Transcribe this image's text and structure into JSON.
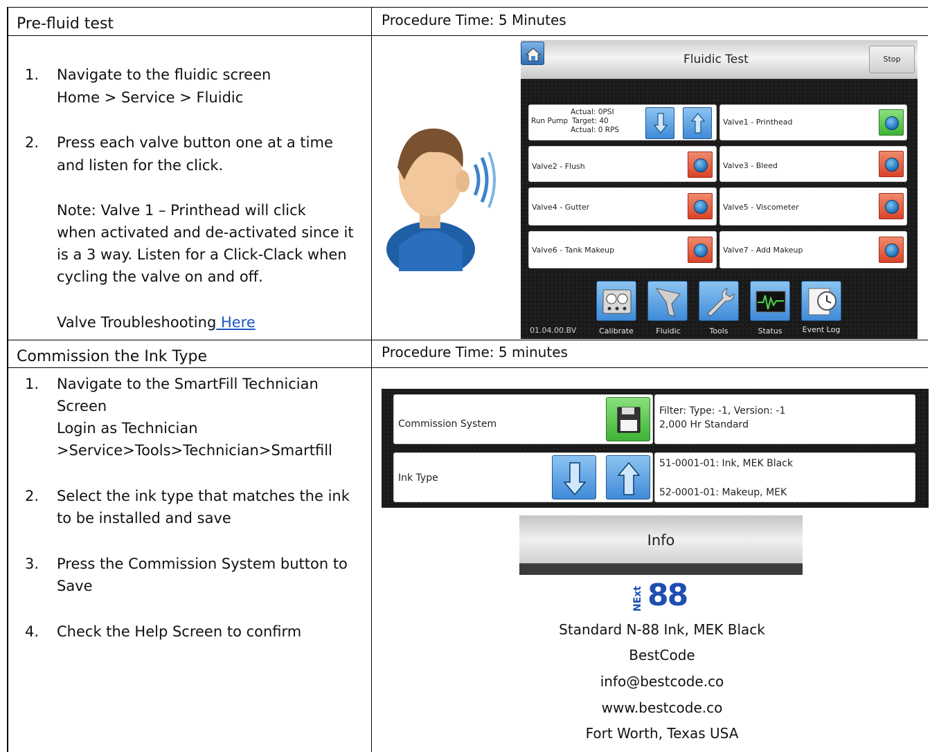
{
  "section1": {
    "title": "Pre-fluid test",
    "procedure_time": "Procedure Time: 5 Minutes",
    "step1_num": "1.",
    "step1_line1": "Navigate to the fluidic screen",
    "step1_line2": "Home > Service > Fluidic",
    "step2_num": "2.",
    "step2_line1": "Press each valve button one at a time",
    "step2_line2": "and listen for the click.",
    "note_line1": "Note: Valve 1 – Printhead will click",
    "note_line2": "when activated and de-activated since it",
    "note_line3": "is a 3 way. Listen for a Click-Clack when",
    "note_line4": "cycling the valve on and off.",
    "trouble_text": "Valve Troubleshooting",
    "trouble_link": " Here"
  },
  "fluidic_screen": {
    "title": "Fluidic Test",
    "stop_label": "Stop",
    "pump_actual_psi": "Actual: 0PSI",
    "pump_label": "Run Pump",
    "pump_target": "Target: 40",
    "pump_actual_rps": "Actual: 0 RPS",
    "valves": [
      "Valve1 - Printhead",
      "Valve2 - Flush",
      "Valve3 - Bleed",
      "Valve4 - Gutter",
      "Valve5 - Viscometer",
      "Valve6 - Tank Makeup",
      "Valve7 - Add Makeup"
    ],
    "version": "01.04.00.BV",
    "nav": [
      "Calibrate",
      "Fluidic",
      "Tools",
      "Status",
      "Event Log"
    ]
  },
  "section2": {
    "title": "Commission the Ink Type",
    "procedure_time": "Procedure Time: 5 minutes",
    "s1_num": "1.",
    "s1_line1": "Navigate to the SmartFill Technician",
    "s1_line2": "Screen",
    "s1_line3": "Login as Technician",
    "s1_line4": ">Service>Tools>Technician>Smartfill",
    "s2_num": "2.",
    "s2_line1": "Select the ink type that matches the ink",
    "s2_line2": "to be installed and save",
    "s3_num": "3.",
    "s3_line1": "Press the Commission System button to",
    "s3_line2": "Save",
    "s4_num": "4.",
    "s4_line1": "Check the Help Screen to confirm"
  },
  "commission_screen": {
    "commission_label": "Commission System",
    "filter_line1": "Filter: Type: -1, Version: -1",
    "filter_line2": "2,000 Hr Standard",
    "ink_type_label": "Ink Type",
    "ink_line1": "51-0001-01: Ink, MEK Black",
    "ink_line2": "52-0001-01: Makeup, MEK"
  },
  "info_screen": {
    "title": "Info",
    "logo_next": "NExt",
    "logo_88": "88",
    "line1": "Standard N-88 Ink, MEK Black",
    "line2": "BestCode",
    "line3": "info@bestcode.co",
    "line4": "www.bestcode.co",
    "line5": "Fort Worth, Texas USA"
  }
}
